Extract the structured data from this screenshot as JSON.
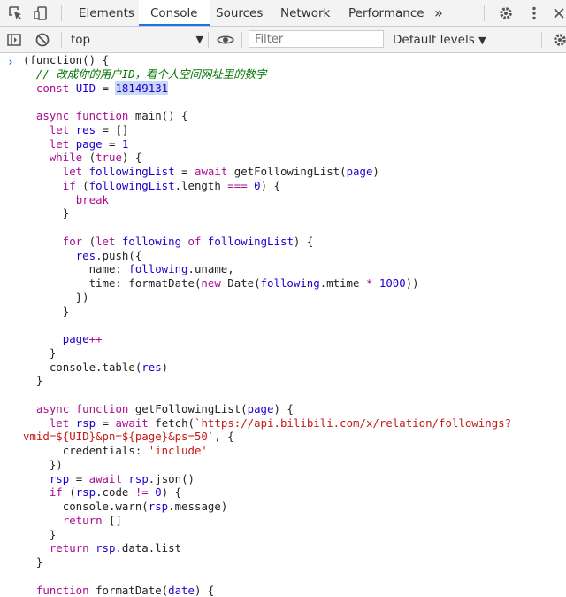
{
  "tabs": {
    "elements": "Elements",
    "console": "Console",
    "sources": "Sources",
    "network": "Network",
    "performance": "Performance",
    "more": "»"
  },
  "toolbar": {
    "context": "top",
    "context_arrow": "▼",
    "filter_placeholder": "Filter",
    "levels": "Default levels",
    "levels_arrow": "▼"
  },
  "colors": {
    "accent": "#1a73e8",
    "keyword": "#aa0d91",
    "variable": "#1c00cf",
    "string": "#c41a16",
    "comment": "#007400"
  },
  "code_lines": [
    [
      {
        "t": "(function() {",
        "c": "p"
      }
    ],
    [
      {
        "t": "  ",
        "c": "p"
      },
      {
        "t": "// 改成你的用户ID，看个人空间网址里的数字",
        "c": "c"
      }
    ],
    [
      {
        "t": "  ",
        "c": "p"
      },
      {
        "t": "const",
        "c": "k"
      },
      {
        "t": " UID ",
        "c": "v"
      },
      {
        "t": "= ",
        "c": "p"
      },
      {
        "t": "18149131",
        "c": "v hl"
      }
    ],
    [
      {
        "t": "",
        "c": "p"
      }
    ],
    [
      {
        "t": "  ",
        "c": "p"
      },
      {
        "t": "async function",
        "c": "k"
      },
      {
        "t": " main() {",
        "c": "p"
      }
    ],
    [
      {
        "t": "    ",
        "c": "p"
      },
      {
        "t": "let",
        "c": "k"
      },
      {
        "t": " res ",
        "c": "v"
      },
      {
        "t": "= []",
        "c": "p"
      }
    ],
    [
      {
        "t": "    ",
        "c": "p"
      },
      {
        "t": "let",
        "c": "k"
      },
      {
        "t": " page ",
        "c": "v"
      },
      {
        "t": "= ",
        "c": "p"
      },
      {
        "t": "1",
        "c": "v"
      }
    ],
    [
      {
        "t": "    ",
        "c": "p"
      },
      {
        "t": "while",
        "c": "k"
      },
      {
        "t": " (",
        "c": "p"
      },
      {
        "t": "true",
        "c": "k"
      },
      {
        "t": ") {",
        "c": "p"
      }
    ],
    [
      {
        "t": "      ",
        "c": "p"
      },
      {
        "t": "let",
        "c": "k"
      },
      {
        "t": " followingList ",
        "c": "v"
      },
      {
        "t": "= ",
        "c": "p"
      },
      {
        "t": "await",
        "c": "k"
      },
      {
        "t": " getFollowingList(",
        "c": "p"
      },
      {
        "t": "page",
        "c": "v"
      },
      {
        "t": ")",
        "c": "p"
      }
    ],
    [
      {
        "t": "      ",
        "c": "p"
      },
      {
        "t": "if",
        "c": "k"
      },
      {
        "t": " (",
        "c": "p"
      },
      {
        "t": "followingList",
        "c": "v"
      },
      {
        "t": ".length ",
        "c": "p"
      },
      {
        "t": "===",
        "c": "k"
      },
      {
        "t": " ",
        "c": "p"
      },
      {
        "t": "0",
        "c": "v"
      },
      {
        "t": ") {",
        "c": "p"
      }
    ],
    [
      {
        "t": "        ",
        "c": "p"
      },
      {
        "t": "break",
        "c": "k"
      }
    ],
    [
      {
        "t": "      }",
        "c": "p"
      }
    ],
    [
      {
        "t": "",
        "c": "p"
      }
    ],
    [
      {
        "t": "      ",
        "c": "p"
      },
      {
        "t": "for",
        "c": "k"
      },
      {
        "t": " (",
        "c": "p"
      },
      {
        "t": "let",
        "c": "k"
      },
      {
        "t": " following ",
        "c": "v"
      },
      {
        "t": "of",
        "c": "k"
      },
      {
        "t": " ",
        "c": "p"
      },
      {
        "t": "followingList",
        "c": "v"
      },
      {
        "t": ") {",
        "c": "p"
      }
    ],
    [
      {
        "t": "        ",
        "c": "p"
      },
      {
        "t": "res",
        "c": "v"
      },
      {
        "t": ".push({",
        "c": "p"
      }
    ],
    [
      {
        "t": "          name: ",
        "c": "p"
      },
      {
        "t": "following",
        "c": "v"
      },
      {
        "t": ".uname,",
        "c": "p"
      }
    ],
    [
      {
        "t": "          time: formatDate(",
        "c": "p"
      },
      {
        "t": "new",
        "c": "k"
      },
      {
        "t": " Date(",
        "c": "p"
      },
      {
        "t": "following",
        "c": "v"
      },
      {
        "t": ".mtime ",
        "c": "p"
      },
      {
        "t": "*",
        "c": "k"
      },
      {
        "t": " ",
        "c": "p"
      },
      {
        "t": "1000",
        "c": "v"
      },
      {
        "t": "))",
        "c": "p"
      }
    ],
    [
      {
        "t": "        })",
        "c": "p"
      }
    ],
    [
      {
        "t": "      }",
        "c": "p"
      }
    ],
    [
      {
        "t": "",
        "c": "p"
      }
    ],
    [
      {
        "t": "      ",
        "c": "p"
      },
      {
        "t": "page",
        "c": "v"
      },
      {
        "t": "++",
        "c": "k"
      }
    ],
    [
      {
        "t": "    }",
        "c": "p"
      }
    ],
    [
      {
        "t": "    console.table(",
        "c": "p"
      },
      {
        "t": "res",
        "c": "v"
      },
      {
        "t": ")",
        "c": "p"
      }
    ],
    [
      {
        "t": "  }",
        "c": "p"
      }
    ],
    [
      {
        "t": "",
        "c": "p"
      }
    ],
    [
      {
        "t": "  ",
        "c": "p"
      },
      {
        "t": "async function",
        "c": "k"
      },
      {
        "t": " getFollowingList(",
        "c": "p"
      },
      {
        "t": "page",
        "c": "v"
      },
      {
        "t": ") {",
        "c": "p"
      }
    ],
    [
      {
        "t": "    ",
        "c": "p"
      },
      {
        "t": "let",
        "c": "k"
      },
      {
        "t": " rsp ",
        "c": "v"
      },
      {
        "t": "= ",
        "c": "p"
      },
      {
        "t": "await",
        "c": "k"
      },
      {
        "t": " fetch(",
        "c": "p"
      },
      {
        "t": "`https://api.bilibili.com/x/relation/followings?",
        "c": "s"
      }
    ],
    [
      {
        "t": "vmid=${UID}&pn=${page}&ps=50`",
        "c": "s"
      },
      {
        "t": ", {",
        "c": "p"
      }
    ],
    [
      {
        "t": "      credentials: ",
        "c": "p"
      },
      {
        "t": "'include'",
        "c": "s"
      }
    ],
    [
      {
        "t": "    })",
        "c": "p"
      }
    ],
    [
      {
        "t": "    ",
        "c": "p"
      },
      {
        "t": "rsp",
        "c": "v"
      },
      {
        "t": " = ",
        "c": "p"
      },
      {
        "t": "await",
        "c": "k"
      },
      {
        "t": " ",
        "c": "p"
      },
      {
        "t": "rsp",
        "c": "v"
      },
      {
        "t": ".json()",
        "c": "p"
      }
    ],
    [
      {
        "t": "    ",
        "c": "p"
      },
      {
        "t": "if",
        "c": "k"
      },
      {
        "t": " (",
        "c": "p"
      },
      {
        "t": "rsp",
        "c": "v"
      },
      {
        "t": ".code ",
        "c": "p"
      },
      {
        "t": "!=",
        "c": "k"
      },
      {
        "t": " ",
        "c": "p"
      },
      {
        "t": "0",
        "c": "v"
      },
      {
        "t": ") {",
        "c": "p"
      }
    ],
    [
      {
        "t": "      console.warn(",
        "c": "p"
      },
      {
        "t": "rsp",
        "c": "v"
      },
      {
        "t": ".message)",
        "c": "p"
      }
    ],
    [
      {
        "t": "      ",
        "c": "p"
      },
      {
        "t": "return",
        "c": "k"
      },
      {
        "t": " []",
        "c": "p"
      }
    ],
    [
      {
        "t": "    }",
        "c": "p"
      }
    ],
    [
      {
        "t": "    ",
        "c": "p"
      },
      {
        "t": "return",
        "c": "k"
      },
      {
        "t": " ",
        "c": "p"
      },
      {
        "t": "rsp",
        "c": "v"
      },
      {
        "t": ".data.list",
        "c": "p"
      }
    ],
    [
      {
        "t": "  }",
        "c": "p"
      }
    ],
    [
      {
        "t": "",
        "c": "p"
      }
    ],
    [
      {
        "t": "  ",
        "c": "p"
      },
      {
        "t": "function",
        "c": "k"
      },
      {
        "t": " formatDate(",
        "c": "p"
      },
      {
        "t": "date",
        "c": "v"
      },
      {
        "t": ") {",
        "c": "p"
      }
    ]
  ]
}
